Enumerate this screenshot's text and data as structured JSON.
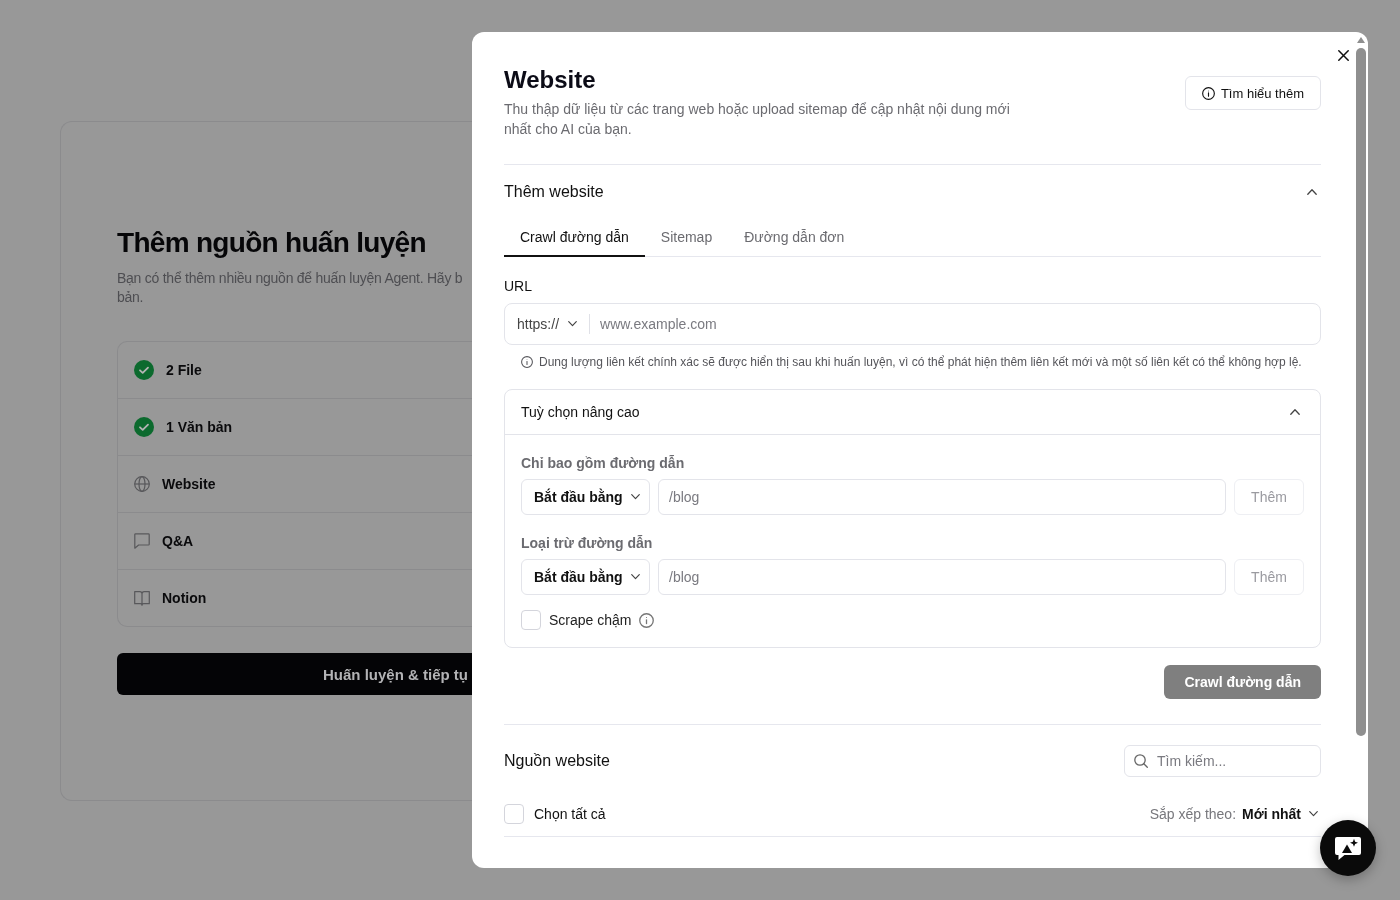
{
  "background_page": {
    "title": "Thêm nguồn huấn luyện",
    "description_lines": [
      "Bạn có thể thêm nhiều nguồn để huấn luyện Agent. Hãy b",
      "bản."
    ],
    "sources": [
      {
        "label": "2 File",
        "kind": "done"
      },
      {
        "label": "1 Văn bản",
        "kind": "done"
      },
      {
        "label": "Website",
        "kind": "website"
      },
      {
        "label": "Q&A",
        "kind": "qa"
      },
      {
        "label": "Notion",
        "kind": "notion"
      }
    ],
    "train_button": "Huấn luyện & tiếp tụ"
  },
  "dialog": {
    "title": "Website",
    "description": "Thu thập dữ liệu từ các trang web hoặc upload sitemap để cập nhật nội dung mới nhất cho AI của bạn.",
    "learn_more_button": "Tìm hiểu thêm",
    "add_section": {
      "title": "Thêm website",
      "expanded": true,
      "tabs": [
        {
          "label": "Crawl đường dẫn",
          "selected": true
        },
        {
          "label": "Sitemap",
          "selected": false
        },
        {
          "label": "Đường dẫn đơn",
          "selected": false
        }
      ],
      "url": {
        "label": "URL",
        "protocol": "https://",
        "placeholder": "www.example.com"
      },
      "note": "Dung lượng liên kết chính xác sẽ được hiển thị sau khi huấn luyện, vì có thể phát hiện thêm liên kết mới và một số liên kết có thể không hợp lệ.",
      "advanced": {
        "title": "Tuỳ chọn nâng cao",
        "expanded": true,
        "filters": [
          {
            "label": "Chỉ bao gồm đường dẫn",
            "match": "Bắt đầu bằng",
            "placeholder": "/blog",
            "add_button": "Thêm",
            "add_disabled": true
          },
          {
            "label": "Loại trừ đường dẫn",
            "match": "Bắt đầu bằng",
            "placeholder": "/blog",
            "add_button": "Thêm",
            "add_disabled": true
          }
        ],
        "slow_scrape": {
          "label": "Scrape chậm",
          "checked": false
        }
      },
      "crawl_button": {
        "label": "Crawl đường dẫn",
        "disabled": true
      }
    },
    "sources_section": {
      "title": "Nguồn website",
      "search_placeholder": "Tìm kiếm...",
      "select_all": {
        "label": "Chọn tất cả",
        "checked": false
      },
      "sort_label": "Sắp xếp theo:",
      "sort_value": "Mới nhất"
    }
  }
}
